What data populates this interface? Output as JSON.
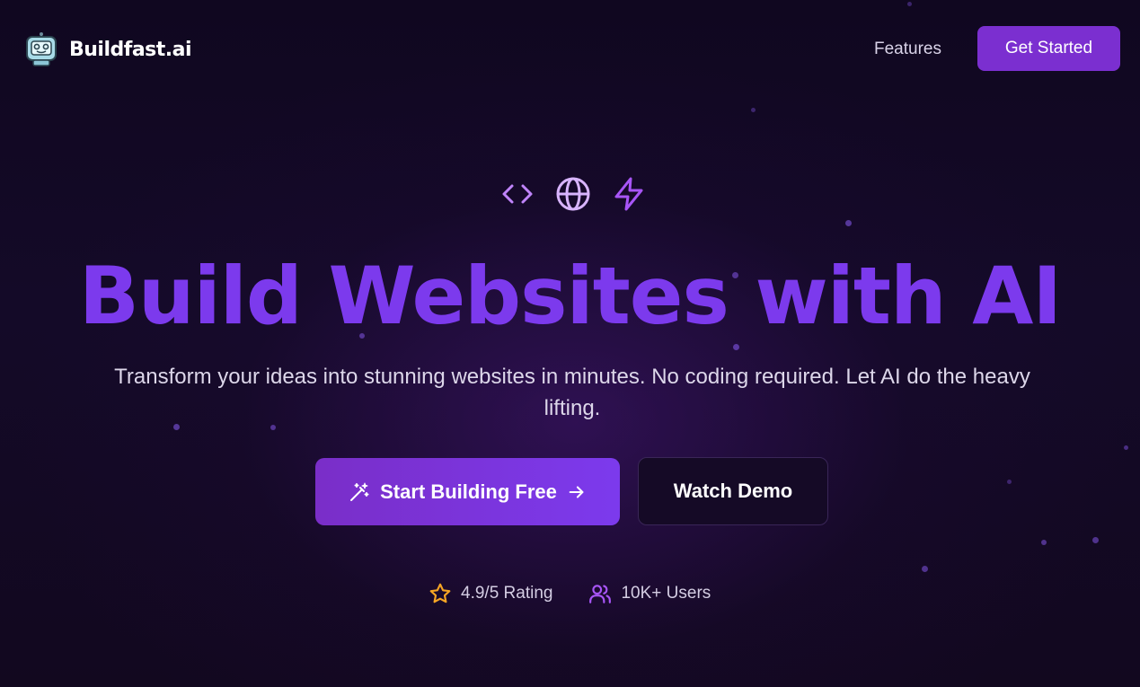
{
  "brand": {
    "name": "Buildfast.ai",
    "logo_icon": "robot-icon"
  },
  "nav": {
    "features_label": "Features",
    "get_started_label": "Get Started"
  },
  "hero": {
    "icons": [
      "code-icon",
      "globe-icon",
      "zap-icon"
    ],
    "headline": "Build Websites with AI",
    "subtitle": "Transform your ideas into stunning websites in minutes. No coding required. Let AI do the heavy lifting.",
    "primary_cta": {
      "label": "Start Building Free",
      "leading_icon": "magic-wand-icon",
      "trailing_icon": "arrow-right-icon"
    },
    "secondary_cta": {
      "label": "Watch Demo"
    }
  },
  "stats": [
    {
      "icon": "star-icon",
      "label": "4.9/5 Rating"
    },
    {
      "icon": "users-icon",
      "label": "10K+ Users"
    }
  ],
  "colors": {
    "accent": "#7c3aed",
    "button_purple": "#7b2fd0",
    "icon_purple": "#c084fc",
    "star_gold": "#f5a524",
    "background": "#12081f"
  }
}
